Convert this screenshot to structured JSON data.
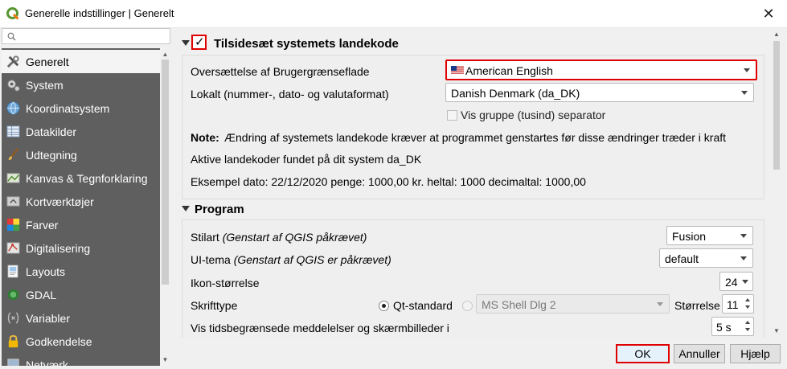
{
  "window": {
    "title": "Generelle indstillinger | Generelt",
    "close_label": "✕"
  },
  "search": {
    "placeholder": "",
    "value": ""
  },
  "sidebar": {
    "items": [
      {
        "label": "Generelt",
        "icon": "wrench-icon",
        "active": true
      },
      {
        "label": "System",
        "icon": "gears-icon"
      },
      {
        "label": "Koordinatsystem",
        "icon": "globe-icon"
      },
      {
        "label": "Datakilder",
        "icon": "table-icon"
      },
      {
        "label": "Udtegning",
        "icon": "brush-icon"
      },
      {
        "label": "Kanvas & Tegnforklaring",
        "icon": "canvas-icon"
      },
      {
        "label": "Kortværktøjer",
        "icon": "map-tools-icon"
      },
      {
        "label": "Farver",
        "icon": "palette-icon"
      },
      {
        "label": "Digitalisering",
        "icon": "digitize-icon"
      },
      {
        "label": "Layouts",
        "icon": "layouts-icon"
      },
      {
        "label": "GDAL",
        "icon": "gdal-icon"
      },
      {
        "label": "Variabler",
        "icon": "variables-icon"
      },
      {
        "label": "Godkendelse",
        "icon": "lock-icon"
      },
      {
        "label": "Netværk",
        "icon": "network-icon"
      }
    ]
  },
  "locale": {
    "section_title": "Tilsidesæt systemets landekode",
    "checked": true,
    "translation_label": "Oversættelse af Brugergrænseflade",
    "translation_value": "American English",
    "locale_label": "Lokalt (nummer-, dato- og valutaformat)",
    "locale_value": "Danish Denmark (da_DK)",
    "group_separator_label": "Vis gruppe (tusind) separator",
    "note_bold": "Note:",
    "note_text": "Ændring af systemets landekode kræver at programmet genstartes før disse ændringer træder i kraft",
    "active_locales": "Aktive landekoder fundet på dit system da_DK",
    "example": "Eksempel dato: 22/12/2020 penge: 1000,00 kr. heltal: 1000 decimaltal: 1000,00"
  },
  "program": {
    "section_title": "Program",
    "style_label": "Stilart",
    "style_hint": "(Genstart af QGIS påkrævet)",
    "style_value": "Fusion",
    "theme_label": "UI-tema",
    "theme_hint": "(Genstart af QGIS er påkrævet)",
    "theme_value": "default",
    "icon_size_label": "Ikon-størrelse",
    "icon_size_value": "24",
    "font_label": "Skrifttype",
    "font_qt_label": "Qt-standard",
    "font_custom_value": "MS Shell Dlg 2",
    "font_size_label": "Størrelse",
    "font_size_value": "11",
    "timeout_label": "Vis tidsbegrænsede meddelelser og skærmbilleder i",
    "timeout_value": "5 s"
  },
  "buttons": {
    "ok": "OK",
    "cancel": "Annuller",
    "help": "Hjælp"
  },
  "colors": {
    "sidebar_bg": "#5f5f5f",
    "highlight": "#e00000"
  }
}
